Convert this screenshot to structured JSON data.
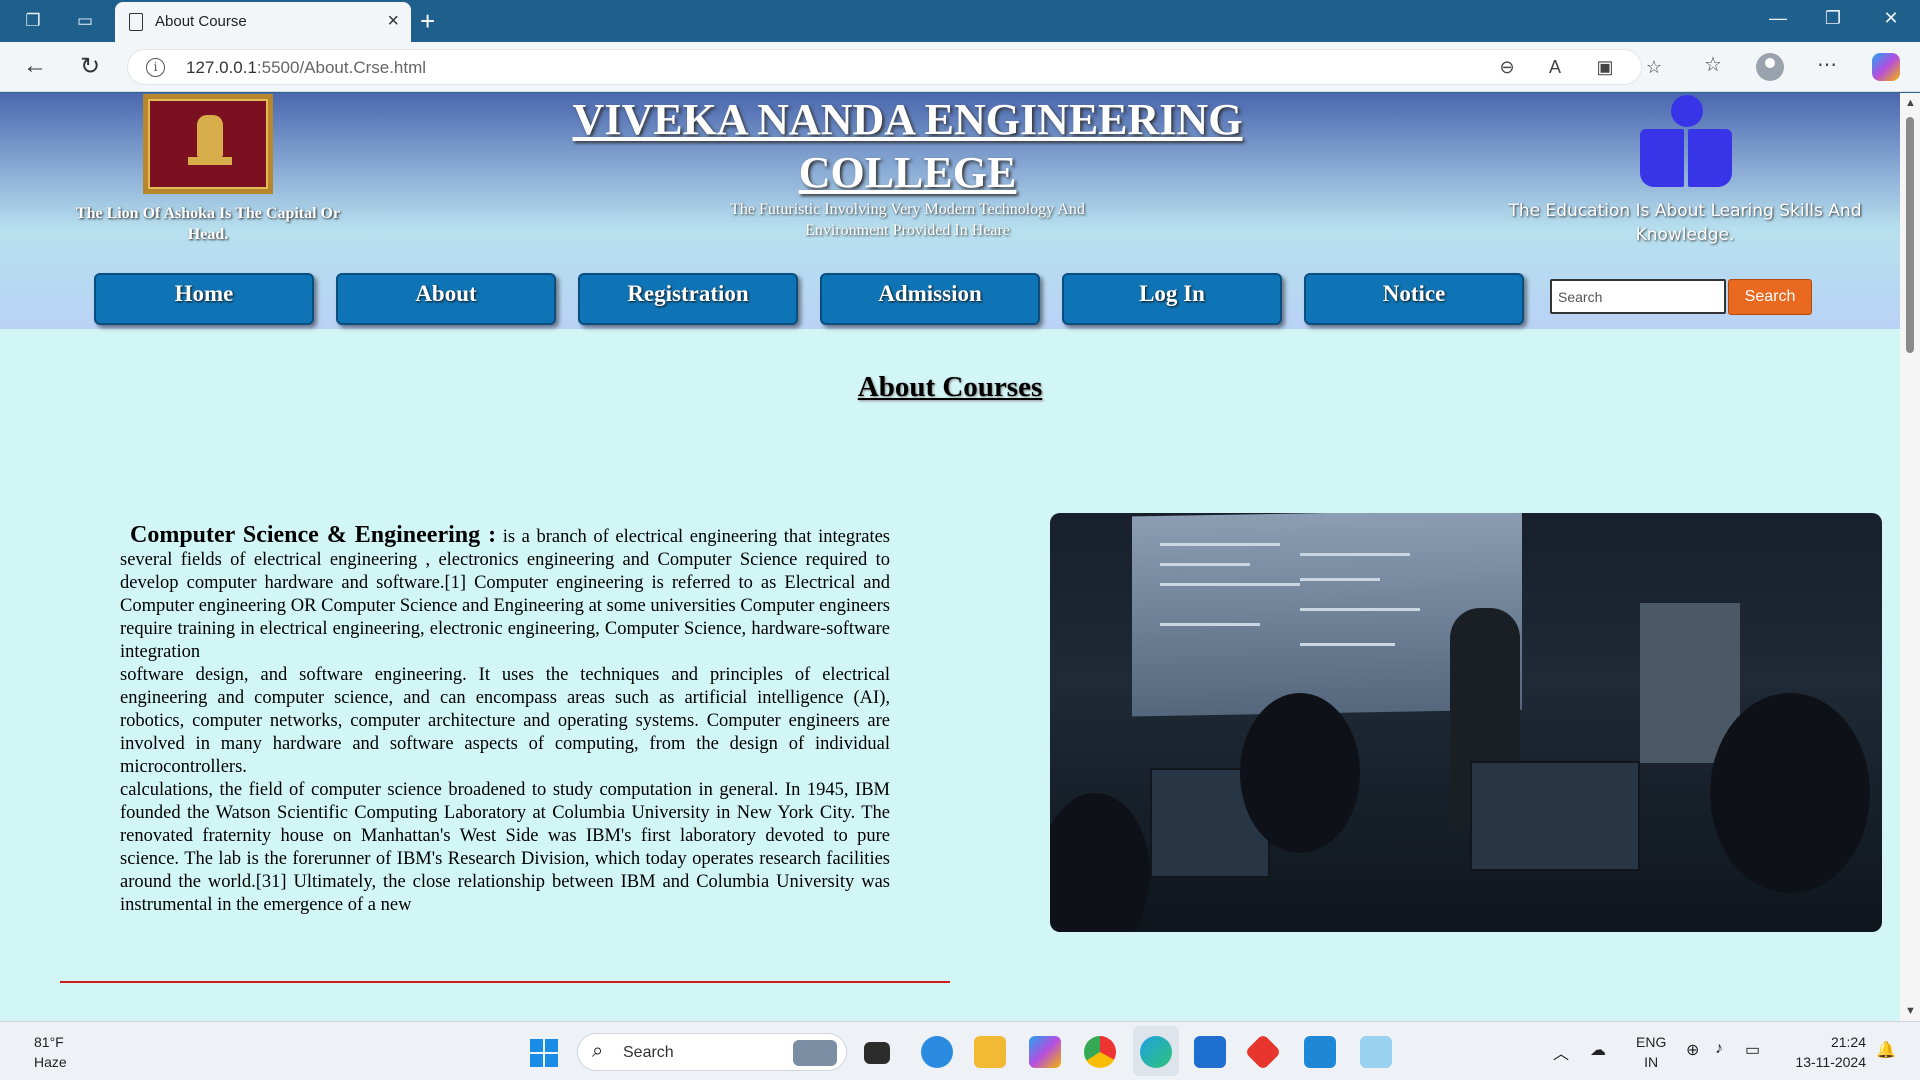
{
  "browser": {
    "tab_title": "About Course",
    "url_host": "127.0.0.1",
    "url_rest": ":5500/About.Crse.html"
  },
  "header": {
    "emblem_caption": "The Lion Of Ashoka Is The Capital Or Head.",
    "college_name": "VIVEKA NANDA ENGINEERING COLLEGE",
    "tagline": "The Futuristic Involving Very Modern Technology And Environment Provided In Heare",
    "education_caption": "The Education Is About Learing Skills And Knowledge."
  },
  "nav": {
    "items": [
      {
        "label": "Home"
      },
      {
        "label": "About"
      },
      {
        "label": "Registration"
      },
      {
        "label": "Admission"
      },
      {
        "label": "Log In"
      },
      {
        "label": "Notice"
      }
    ],
    "search_placeholder": "Search",
    "search_button": "Search"
  },
  "main": {
    "heading": "About Courses",
    "lead_title": "Computer Science & Engineering :",
    "paragraph1": " is a branch of electrical engineering that integrates several fields of electrical engineering , electronics engineering and Computer Science required to develop computer hardware and software.[1] Computer engineering is referred to as Electrical and Computer engineering OR Computer Science and Engineering at some universities Computer engineers require training in electrical engineering, electronic engineering, Computer Science, hardware-software integration",
    "paragraph2": "software design, and software engineering. It uses the techniques and principles of electrical engineering and computer science, and can encompass areas such as artificial intelligence (AI), robotics, computer networks, computer architecture and operating systems. Computer engineers are involved in many hardware and software aspects of computing, from the design of individual microcontrollers.",
    "paragraph3": "calculations, the field of computer science broadened to study computation in general. In 1945, IBM founded the Watson Scientific Computing Laboratory at Columbia University in New York City. The renovated fraternity house on Manhattan's West Side was IBM's first laboratory devoted to pure science. The lab is the forerunner of IBM's Research Division, which today operates research facilities around the world.[31] Ultimately, the close relationship between IBM and Columbia University was instrumental in the emergence of a new"
  },
  "taskbar": {
    "temperature": "81°F",
    "weather": "Haze",
    "search_label": "Search",
    "lang_top": "ENG",
    "lang_bottom": "IN",
    "time": "21:24",
    "date": "13-11-2024"
  },
  "colors": {
    "nav_button": "#0f74b5",
    "search_button": "#e8691f",
    "page_bg": "#d2f5f5",
    "rule": "#d11c1c"
  }
}
